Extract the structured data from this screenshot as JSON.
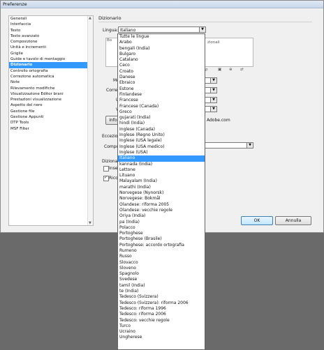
{
  "window": {
    "title": "Preferenze"
  },
  "sidebar": {
    "items": [
      "Generali",
      "Interfaccia",
      "Testo",
      "Testo avanzato",
      "Composizione",
      "Unità e incrementi",
      "Griglie",
      "Guide e tavolo di montaggio",
      "Dizionario",
      "Controllo ortografia",
      "Correzione automatica",
      "Note",
      "Rilevamento modifiche",
      "Visualizzazione Editor brani",
      "Prestazioni visualizzazione",
      "Aspetto del nero",
      "Gestione file",
      "Gestione Appunti",
      "DTP Tools",
      "MSF Filter"
    ],
    "selected_index": 8
  },
  "panel": {
    "title": "Dizionario",
    "lingua_label": "Lingua:",
    "lingua_value": "Italiano",
    "partial_bo": "Bo",
    "partial_zionali": "zionali",
    "partial_mo": "Mo",
    "partial_corre": "Corre",
    "partial_u": "U",
    "partial_v": "V",
    "partial_info": "Info",
    "adobe_com": "Adobe.com",
    "eccezioni_label": "Eccezio",
    "compor_label": "Compor",
    "dizionari_label": "Dizionar",
    "inser_label": "Inser",
    "ricor_label": "Ricor"
  },
  "buttons": {
    "ok": "OK",
    "cancel": "Annulla"
  },
  "dropdown": {
    "options": [
      "Tutte le lingue",
      "Arabo",
      "bengali (India)",
      "Bulgaro",
      "Catalano",
      "Ceco",
      "Croato",
      "Danese",
      "Ebraico",
      "Estone",
      "Finlandese",
      "Francese",
      "Francese (Canada)",
      "Greco",
      "gujarati (India)",
      "hindi (India)",
      "Inglese (Canada)",
      "Inglese (Regno Unito)",
      "Inglese (USA legale)",
      "Inglese (USA medico)",
      "Inglese (USA)",
      "Italiano",
      "kannada (India)",
      "Lettone",
      "Lituano",
      "Malayalam (India)",
      "marathi (India)",
      "Norvegese (Nynorsk)",
      "Norvegese: Bokmål",
      "Olandese: riforma 2005",
      "Olandese: vecchie regole",
      "Oriya (India)",
      "pa (India)",
      "Polacco",
      "Portoghese",
      "Portoghese (Brasile)",
      "Portoghese: accordo ortografia",
      "Rumeno",
      "Russo",
      "Slovacco",
      "Sloveno",
      "Spagnolo",
      "Svedese",
      "tamil (India)",
      "te (India)",
      "Tedesco (Svizzera)",
      "Tedesco (Svizzera): riforma 2006",
      "Tedesco: riforma 1996",
      "Tedesco: riforma 2006",
      "Tedesco: vecchie regole",
      "Turco",
      "Ucraino",
      "Ungherese"
    ],
    "selected_index": 21
  }
}
